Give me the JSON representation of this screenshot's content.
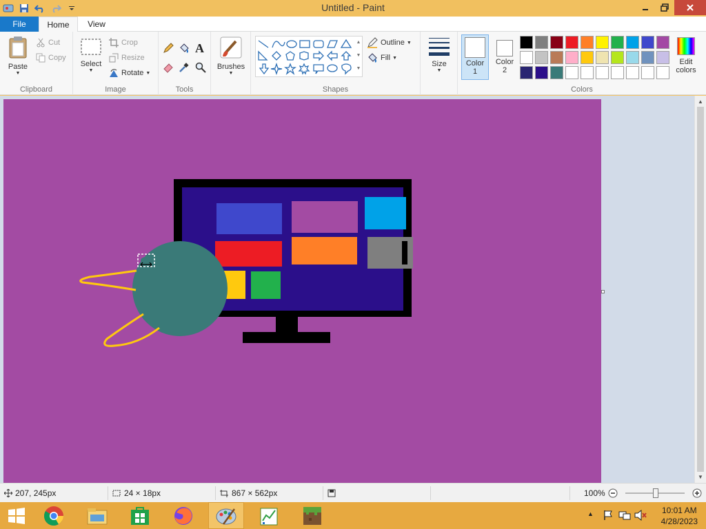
{
  "window": {
    "title": "Untitled - Paint",
    "titlebar_color": "#f1c05f"
  },
  "tabs": {
    "file": "File",
    "home": "Home",
    "view": "View"
  },
  "clipboard": {
    "paste": "Paste",
    "cut": "Cut",
    "copy": "Copy",
    "group": "Clipboard"
  },
  "image": {
    "select": "Select",
    "crop": "Crop",
    "resize": "Resize",
    "rotate": "Rotate",
    "group": "Image"
  },
  "tools": {
    "group": "Tools",
    "text_glyph": "A"
  },
  "brushes": {
    "label": "Brushes"
  },
  "shapes": {
    "outline": "Outline",
    "fill": "Fill",
    "group": "Shapes"
  },
  "size": {
    "label": "Size"
  },
  "colors": {
    "color1_line1": "Color",
    "color1_line2": "1",
    "color2_line1": "Color",
    "color2_line2": "2",
    "edit_line1": "Edit",
    "edit_line2": "colors",
    "group": "Colors",
    "palette_row1": [
      "#000000",
      "#7f7f7f",
      "#880015",
      "#ed1c24",
      "#ff7f27",
      "#fff200",
      "#22b14c",
      "#00a2e8",
      "#3f48cc",
      "#a349a4"
    ],
    "palette_row2": [
      "#ffffff",
      "#c3c3c3",
      "#b97a57",
      "#ffaec9",
      "#ffc90e",
      "#efe4b0",
      "#b5e61d",
      "#99d9ea",
      "#7092be",
      "#c8bfe7"
    ],
    "palette_row3": [
      "#2a2672",
      "#2b0f8a",
      "#3a7a78",
      "#ffffff",
      "#ffffff",
      "#ffffff",
      "#ffffff",
      "#ffffff",
      "#ffffff",
      "#ffffff"
    ]
  },
  "status": {
    "cursor_pos": "207, 245px",
    "selection_size": "24 × 18px",
    "canvas_size": "867 × 562px",
    "zoom": "100%"
  },
  "taskbar": {
    "time": "10:01 AM",
    "date": "4/28/2023"
  },
  "canvas_colors": {
    "background": "#a34ba3",
    "monitor_frame": "#000000",
    "screen": "#2b0f8a",
    "circle": "#3a7a78",
    "lines": "#ffc90e"
  }
}
